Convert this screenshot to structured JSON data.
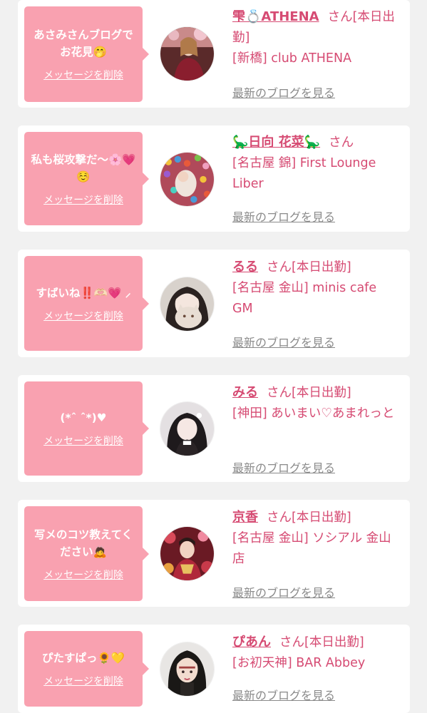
{
  "theme": {
    "accent": "#d64b73",
    "bubble": "#f9a1b0",
    "bg": "#f1f1f1",
    "card": "#ffffff",
    "link_gray": "#8a8a8a"
  },
  "entries": [
    {
      "message": "あさみさんブログでお花見🤭",
      "delete_label": "メッセージを削除",
      "name": "雫💍ATHENA",
      "honorific": "さん",
      "status": "[本日出勤]",
      "shop": "[新橋] club ATHENA",
      "blog_link": "最新のブログを見る"
    },
    {
      "message": "私も桜攻撃だ〜🌸💗☺️",
      "delete_label": "メッセージを削除",
      "name": "🦕日向 花菜🦕",
      "honorific": "さん",
      "status": "",
      "shop": "[名古屋 錦] First Lounge Liber",
      "blog_link": "最新のブログを見る"
    },
    {
      "message": "すばいね‼️🫶🏻💗 ⸝",
      "delete_label": "メッセージを削除",
      "name": "るる",
      "honorific": "さん",
      "status": "[本日出勤]",
      "shop": "[名古屋 金山] minis cafe GM",
      "blog_link": "最新のブログを見る"
    },
    {
      "message": "(*ˆ ˆ*)♥",
      "delete_label": "メッセージを削除",
      "name": "みる",
      "honorific": "さん",
      "status": "[本日出勤]",
      "shop": "[神田] あいまい♡あまれっと",
      "blog_link": "最新のブログを見る"
    },
    {
      "message": "写メのコツ教えてください🙇",
      "delete_label": "メッセージを削除",
      "name": "京香",
      "honorific": "さん",
      "status": "[本日出勤]",
      "shop": "[名古屋 金山] ソシアル 金山店",
      "blog_link": "最新のブログを見る"
    },
    {
      "message": "ぴたすぱっ🌻💛",
      "delete_label": "メッセージを削除",
      "name": "ぴあん",
      "honorific": "さん",
      "status": "[本日出勤]",
      "shop": "[お初天神] BAR Abbey",
      "blog_link": "最新のブログを見る"
    }
  ]
}
